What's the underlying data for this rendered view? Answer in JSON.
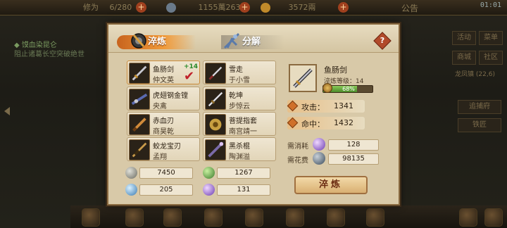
{
  "topbar": {
    "power_label": "修为",
    "power_value": "6/280",
    "copper": "1155萬263文",
    "gold": "3572兩",
    "announce": "公告",
    "clock": "01:01"
  },
  "quest": {
    "title": "◆ 馍血染昆仑",
    "desc": "阻止诸葛长空突破绝世"
  },
  "right_menu": [
    "活动",
    "菜单",
    "商城",
    "社区",
    "龙凤镇",
    "追捕府",
    "铁匠"
  ],
  "right_menu_extra": "(22,6)",
  "tabs": {
    "forge": "淬炼",
    "decompose": "分解",
    "help": "?"
  },
  "items": [
    {
      "name": "鱼肠剑",
      "owner": "仲文英",
      "level": "+14",
      "selected": true
    },
    {
      "name": "雪走",
      "owner": "于小雪"
    },
    {
      "name": "虎翅钢金镗",
      "owner": "央禽"
    },
    {
      "name": "乾坤",
      "owner": "步惊云"
    },
    {
      "name": "赤血刃",
      "owner": "商昊乾"
    },
    {
      "name": "菩提指套",
      "owner": "南宫靖一"
    },
    {
      "name": "蛟龙宝刃",
      "owner": "孟翔"
    },
    {
      "name": "黑杀棍",
      "owner": "陶渊溢"
    }
  ],
  "resources": [
    {
      "value": "7450",
      "color": "#9a9a90"
    },
    {
      "value": "1267",
      "color": "#6aaa4a"
    },
    {
      "value": "205",
      "color": "#7ab0d8"
    },
    {
      "value": "131",
      "color": "#a07ad0"
    }
  ],
  "detail": {
    "name": "鱼肠剑",
    "level_label": "淬炼等级：14",
    "progress_text": "68%",
    "progress": 0.68
  },
  "stats": [
    {
      "label": "攻击：",
      "value": "1341"
    },
    {
      "label": "命中：",
      "value": "1432"
    }
  ],
  "costs": [
    {
      "label": "需消耗",
      "value": "128",
      "color": "#a07ad0"
    },
    {
      "label": "需花费",
      "value": "98135",
      "color": "#7a8a9a"
    }
  ],
  "forge_button": "淬炼"
}
